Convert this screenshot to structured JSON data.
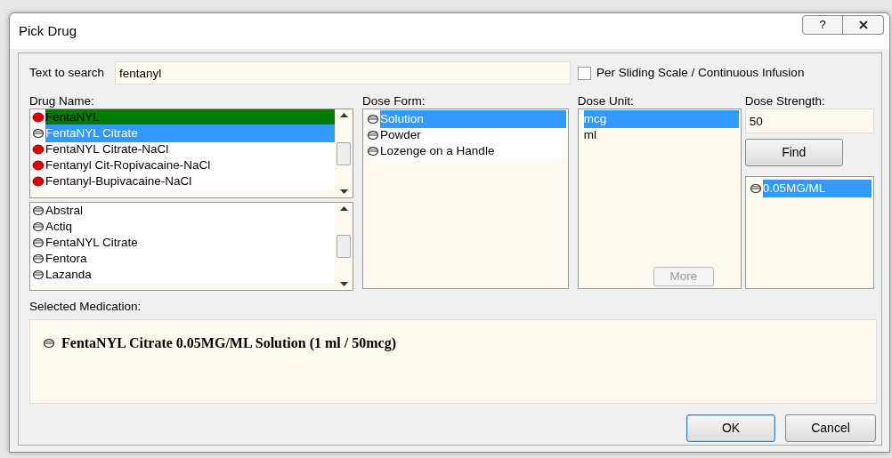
{
  "window": {
    "title": "Pick Drug",
    "buttons": [
      {
        "kind": "help",
        "label": "?"
      }
    ]
  },
  "search": {
    "label": "Text to search",
    "value": "fentanyl"
  },
  "sliding_scale": {
    "label": "Per Sliding Scale / Continuous Infusion",
    "checked": false
  },
  "drug_name": {
    "label": "Drug Name:",
    "items": [
      {
        "text": "FentaNYL",
        "kind": "filled",
        "flagged": true,
        "selected": false
      },
      {
        "text": "FentaNYL Citrate",
        "kind": "outline",
        "flagged": false,
        "selected": true
      },
      {
        "text": "FentaNYL Citrate-NaCl",
        "kind": "filled",
        "flagged": false,
        "selected": false
      },
      {
        "text": "Fentanyl Cit-Ropivacaine-NaCl",
        "kind": "filled",
        "flagged": false,
        "selected": false
      },
      {
        "text": "Fentanyl-Bupivacaine-NaCl",
        "kind": "filled",
        "flagged": false,
        "selected": false
      }
    ]
  },
  "brand_names": {
    "items": [
      {
        "text": "Abstral",
        "kind": "outline",
        "selected": false
      },
      {
        "text": "Actiq",
        "kind": "outline",
        "selected": false
      },
      {
        "text": "FentaNYL Citrate",
        "kind": "outline",
        "selected": false
      },
      {
        "text": "Fentora",
        "kind": "outline",
        "selected": false
      },
      {
        "text": "Lazanda",
        "kind": "outline",
        "selected": false
      }
    ]
  },
  "dose_form": {
    "label": "Dose Form:",
    "items": [
      {
        "text": "Solution",
        "selected": true
      },
      {
        "text": "Powder",
        "selected": false
      },
      {
        "text": "Lozenge on a Handle",
        "selected": false
      }
    ]
  },
  "dose_unit": {
    "label": "Dose Unit:",
    "items": [
      {
        "text": "mcg",
        "selected": true
      },
      {
        "text": "ml",
        "selected": false
      }
    ],
    "more_button": {
      "label": "More",
      "disabled": true
    }
  },
  "dose_strength": {
    "label": "Dose Strength:",
    "value": "50",
    "find_button": "Find",
    "items": [
      {
        "text": "0.05MG/ML",
        "selected": true
      }
    ]
  },
  "selected_medication": {
    "label": "Selected Medication:",
    "text": "FentaNYL Citrate 0.05MG/ML Solution (1 ml / 50mcg)"
  },
  "buttons": [
    {
      "label": "OK",
      "default": true
    },
    {
      "label": "Cancel",
      "default": false
    }
  ]
}
